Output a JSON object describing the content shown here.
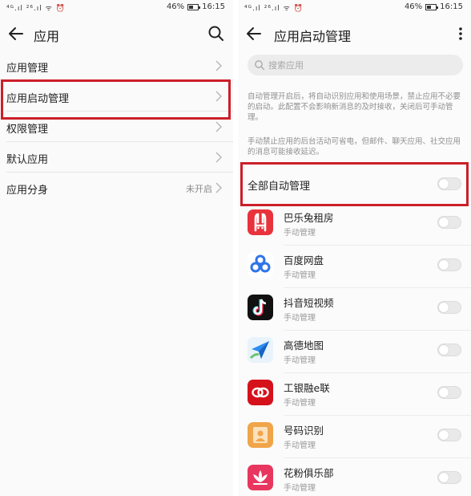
{
  "left": {
    "status": {
      "signal": "⁴ᴳ.ıl ²⁶.ıl ᯤ ⏰",
      "battery": "46%",
      "time": "16:15"
    },
    "header": {
      "title": "应用"
    },
    "menu": [
      {
        "label": "应用管理",
        "value": ""
      },
      {
        "label": "应用启动管理",
        "value": ""
      },
      {
        "label": "权限管理",
        "value": ""
      },
      {
        "label": "默认应用",
        "value": ""
      },
      {
        "label": "应用分身",
        "value": "未开启"
      }
    ]
  },
  "right": {
    "status": {
      "signal": "⁴ᴳ.ıl ²⁶.ıl ᯤ ⏰",
      "battery": "46%",
      "time": "16:15"
    },
    "header": {
      "title": "应用启动管理"
    },
    "search": {
      "placeholder": "搜索应用",
      "value": ""
    },
    "desc1": "自动管理开启后，将自动识别应用和使用场景，禁止应用不必要的启动。此配置不会影响新消息的及时接收，关闭后可手动管理。",
    "desc2": "手动禁止应用的后台活动可省电，但邮件、聊天应用、社交应用的消息可能接收延迟。",
    "all_label": "全部自动管理",
    "all_on": false,
    "apps": [
      {
        "name": "巴乐兔租房",
        "sub": "手动管理",
        "icon": "baletu-rabbit-icon",
        "color": "#e8333c",
        "on": false
      },
      {
        "name": "百度网盘",
        "sub": "手动管理",
        "icon": "baidu-netdisk-icon",
        "color": "#2f74e8",
        "on": false
      },
      {
        "name": "抖音短视频",
        "sub": "手动管理",
        "icon": "douyin-note-icon",
        "color": "#111111",
        "on": false
      },
      {
        "name": "高德地图",
        "sub": "手动管理",
        "icon": "amap-arrow-icon",
        "color": "#2d8cf0",
        "on": false
      },
      {
        "name": "工银融e联",
        "sub": "手动管理",
        "icon": "icbc-rongelian-icon",
        "color": "#d5111c",
        "on": false
      },
      {
        "name": "号码识别",
        "sub": "手动管理",
        "icon": "caller-id-icon",
        "color": "#f0a54a",
        "on": false
      },
      {
        "name": "花粉俱乐部",
        "sub": "手动管理",
        "icon": "huafen-club-flower-icon",
        "color": "#e8365e",
        "on": false
      }
    ]
  },
  "colors": {
    "highlight": "#cc1f2a"
  }
}
